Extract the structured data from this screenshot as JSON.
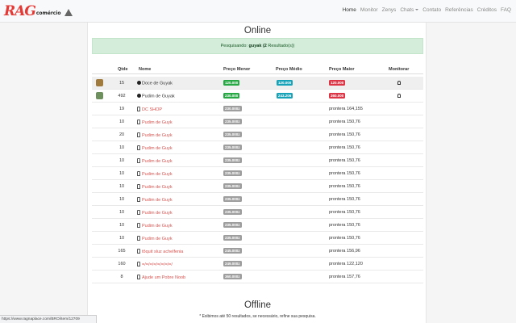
{
  "brand": {
    "logo": "RAG",
    "suffix": "comércio",
    "warning_icon": "warning-icon"
  },
  "nav": {
    "items": [
      {
        "label": "Home",
        "active": true
      },
      {
        "label": "Monitor"
      },
      {
        "label": "Zenys"
      },
      {
        "label": "Chats",
        "dropdown": true
      },
      {
        "label": "Contato"
      },
      {
        "label": "Referências"
      },
      {
        "label": "Créditos"
      },
      {
        "label": "FAQ"
      }
    ]
  },
  "online": {
    "title": "Online",
    "alert_prefix": "Pesquisando:",
    "alert_term": "guyak",
    "alert_count": "(2",
    "alert_suffix": "Resultado(s))",
    "headers": {
      "qty": "Qtde",
      "name": "Nome",
      "min": "Preço Menor",
      "avg": "Preço Médio",
      "max": "Preço Maior",
      "monitor": "Monitorar"
    },
    "summary": [
      {
        "qty": "15",
        "name": "Doce de Guyak",
        "min": "120.000",
        "avg": "120.000",
        "max": "120.000",
        "thumb": "#a07a3c"
      },
      {
        "qty": "492",
        "name": "Pudim de Guyak",
        "min": "230.000",
        "avg": "243.206",
        "max": "360.000",
        "thumb": "#6e8f5e"
      }
    ],
    "shops": [
      {
        "qty": "19",
        "name": "DC SHOP",
        "price": "230.000z",
        "location": "prontera 164,155"
      },
      {
        "qty": "10",
        "name": "Pudim de Guyk",
        "price": "235.000z",
        "location": "prontera 150,76"
      },
      {
        "qty": "20",
        "name": "Pudim de Guyk",
        "price": "235.000z",
        "location": "prontera 150,76"
      },
      {
        "qty": "10",
        "name": "Pudim de Guyk",
        "price": "235.000z",
        "location": "prontera 150,76"
      },
      {
        "qty": "10",
        "name": "Pudim de Guyk",
        "price": "235.000z",
        "location": "prontera 150,76"
      },
      {
        "qty": "10",
        "name": "Pudim de Guyk",
        "price": "235.000z",
        "location": "prontera 150,76"
      },
      {
        "qty": "10",
        "name": "Pudim de Guyk",
        "price": "235.000z",
        "location": "prontera 150,76"
      },
      {
        "qty": "10",
        "name": "Pudim de Guyk",
        "price": "235.000z",
        "location": "prontera 150,76"
      },
      {
        "qty": "10",
        "name": "Pudim de Guyk",
        "price": "235.000z",
        "location": "prontera 150,76"
      },
      {
        "qty": "10",
        "name": "Pudim de Guyk",
        "price": "235.000z",
        "location": "prontera 150,76"
      },
      {
        "qty": "10",
        "name": "Pudim de Guyk",
        "price": "235.000z",
        "location": "prontera 150,76"
      },
      {
        "qty": "165",
        "name": "tõquit sluz achelfenia",
        "price": "245.000z",
        "location": "prontera 156,96"
      },
      {
        "qty": "160",
        "name": "=/=/=/=/=/=/=/=/",
        "price": "249.000z",
        "location": "prontera 122,120"
      },
      {
        "qty": "8",
        "name": "Ajude um Pobre Noob",
        "price": "360.000z",
        "location": "prontera 157,76"
      }
    ],
    "footnote": "* Exibimos até 50 resultados, se necessário, refine sua pesquisa."
  },
  "offline": {
    "title": "Offline"
  },
  "statusbar": {
    "url": "https://www.ragnaplace.com/BRO/item/12709"
  }
}
